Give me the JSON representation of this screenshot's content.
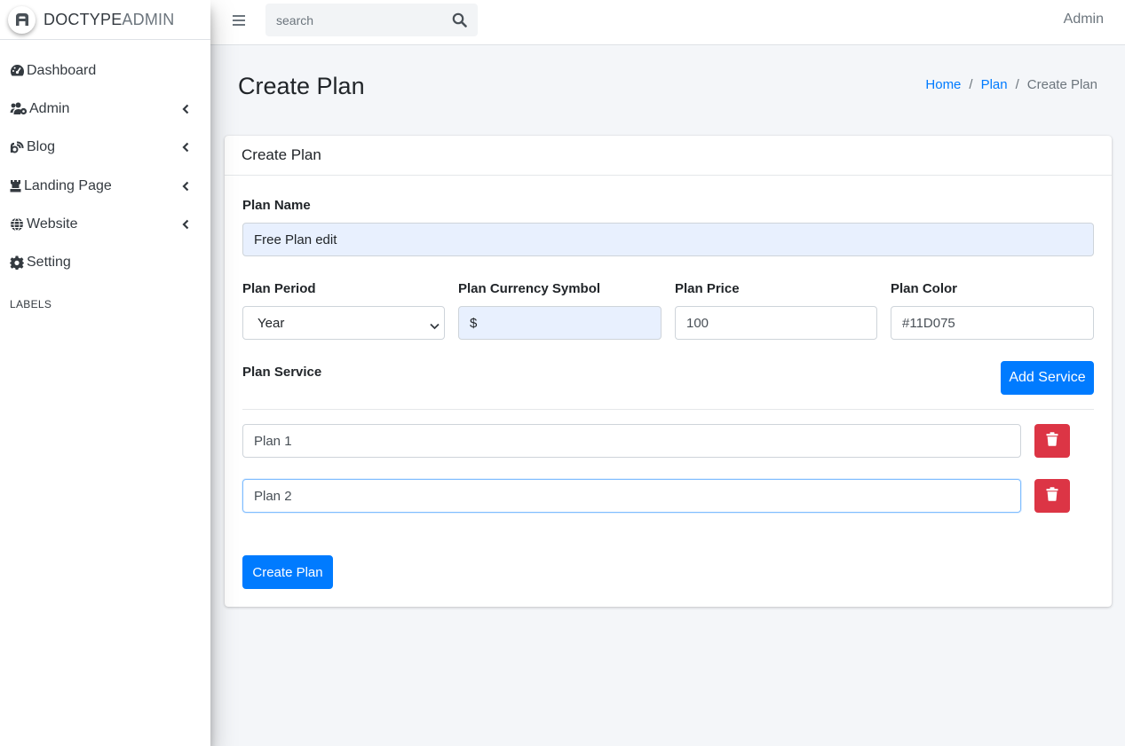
{
  "brand": {
    "bold": "DOCTYPE",
    "light": "ADMIN"
  },
  "sidebar": {
    "items": [
      {
        "label": "Dashboard",
        "icon": "tachometer-icon",
        "has_chevron": false
      },
      {
        "label": "Admin",
        "icon": "users-cog-icon",
        "has_chevron": true
      },
      {
        "label": "Blog",
        "icon": "blog-icon",
        "has_chevron": true
      },
      {
        "label": "Landing Page",
        "icon": "chess-rook-icon",
        "has_chevron": true
      },
      {
        "label": "Website",
        "icon": "globe-icon",
        "has_chevron": true
      },
      {
        "label": "Setting",
        "icon": "gear-icon",
        "has_chevron": false
      }
    ],
    "section_header": "LABELS"
  },
  "topbar": {
    "search_placeholder": "search",
    "user_label": "Admin"
  },
  "page": {
    "title": "Create Plan",
    "breadcrumb": [
      "Home",
      "Plan",
      "Create Plan"
    ]
  },
  "form": {
    "card_title": "Create Plan",
    "plan_name": {
      "label": "Plan Name",
      "value": "Free Plan edit"
    },
    "plan_period": {
      "label": "Plan Period",
      "value": "Year"
    },
    "currency": {
      "label": "Plan Currency Symbol",
      "value": "$"
    },
    "price": {
      "label": "Plan Price",
      "value": "100"
    },
    "color": {
      "label": "Plan Color",
      "value": "#11D075"
    },
    "service_label": "Plan Service",
    "add_service_label": "Add Service",
    "services": [
      {
        "value": "Plan 1"
      },
      {
        "value": "Plan 2"
      }
    ],
    "submit_label": "Create Plan"
  },
  "colors": {
    "primary": "#007bff",
    "danger": "#dc3545",
    "autofill": "#e8f0fe",
    "background": "#f4f6f9"
  }
}
